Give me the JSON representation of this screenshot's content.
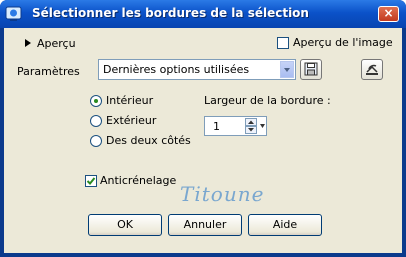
{
  "window": {
    "title": "Sélectionner les bordures de la sélection",
    "close_glyph": "×"
  },
  "preview": {
    "toggle_label": "Aperçu",
    "image_preview_label": "Aperçu de l'image",
    "image_preview_checked": false
  },
  "params": {
    "label": "Paramètres",
    "preset_value": "Dernières options utilisées"
  },
  "position": {
    "options": [
      "Intérieur",
      "Extérieur",
      "Des deux côtés"
    ],
    "selected": "Intérieur"
  },
  "border_width": {
    "label": "Largeur de la bordure :",
    "value": "1"
  },
  "antialias": {
    "label": "Anticrénelage",
    "checked": true
  },
  "watermark": "Titoune",
  "buttons": {
    "ok": "OK",
    "cancel": "Annuler",
    "help": "Aide"
  },
  "icons": {
    "app": "app-icon",
    "save_preset": "floppy-icon",
    "reset": "reset-icon"
  }
}
